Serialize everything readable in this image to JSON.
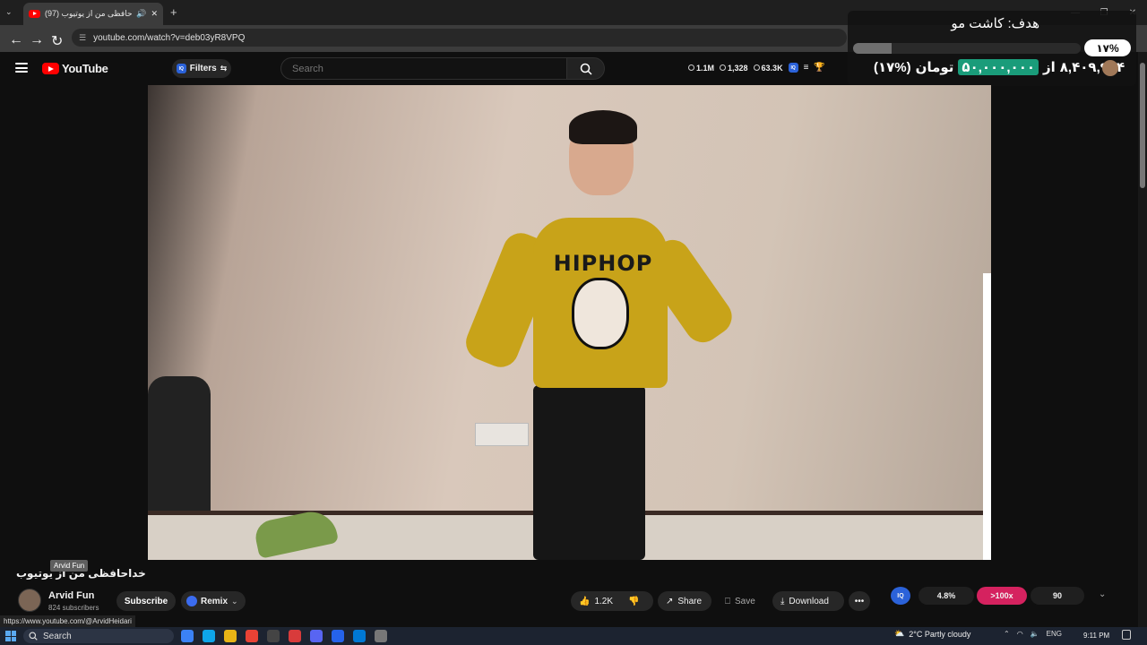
{
  "tab": {
    "title": "(97) خداحافظی من از یوتیوب"
  },
  "address": {
    "url": "youtube.com/watch?v=deb03yR8VPQ"
  },
  "header": {
    "logo_text": "YouTube",
    "filters_label": "Filters",
    "search_placeholder": "Search",
    "stats": [
      {
        "icon": "clock-icon",
        "value": "1.1M"
      },
      {
        "icon": "eye-icon",
        "value": "1,328"
      },
      {
        "icon": "eye-icon",
        "value": "63.3K"
      }
    ]
  },
  "overlay": {
    "goal_label": "هدف: کاشت مو",
    "percent": "۱۷%",
    "progress_fraction": 0.17,
    "raised": "۸,۴۰۹,۹۹۴",
    "of_word": "از",
    "target": "۵۰,۰۰۰,۰۰۰",
    "currency": "تومان",
    "percent_paren": "(۱۷%)"
  },
  "video": {
    "shirt_text": "HIPHOP",
    "title": "خداحافظی من از یوتیوب"
  },
  "channel": {
    "tooltip": "Arvid Fun",
    "name": "Arvid Fun",
    "subscribers": "824 subscribers",
    "subscribe_label": "Subscribe",
    "remix_label": "Remix"
  },
  "actions": {
    "like_count": "1.2K",
    "share_label": "Share",
    "save_label": "Save",
    "download_label": "Download"
  },
  "metrics": {
    "iq_label": "IQ",
    "engagement": "4.8%",
    "ratio": ">100x",
    "score": "90"
  },
  "status_url": "https://www.youtube.com/@ArvidHeidari",
  "taskbar": {
    "search_label": "Search",
    "weather": "2°C  Partly cloudy",
    "lang": "ENG",
    "time": "9:11 PM"
  },
  "colors": {
    "brand": "#ff0000",
    "accent": "#2b62d9",
    "progress_goal": "#1a9c7a",
    "ratio_badge": "#d5225f"
  }
}
